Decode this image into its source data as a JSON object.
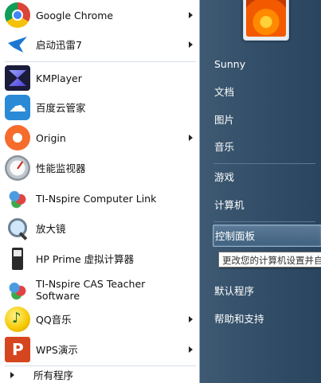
{
  "programs": [
    {
      "label": "Google Chrome",
      "icon": "chrome-icon",
      "has_submenu": true
    },
    {
      "label": "启动迅雷7",
      "icon": "xunlei-icon",
      "has_submenu": true
    },
    {
      "label": "KMPlayer",
      "icon": "kmplayer-icon",
      "has_submenu": false
    },
    {
      "label": "百度云管家",
      "icon": "baidu-cloud-icon",
      "has_submenu": false
    },
    {
      "label": "Origin",
      "icon": "origin-icon",
      "has_submenu": true
    },
    {
      "label": "性能监视器",
      "icon": "performance-monitor-icon",
      "has_submenu": false
    },
    {
      "label": "TI-Nspire Computer Link",
      "icon": "ti-nspire-icon",
      "has_submenu": false
    },
    {
      "label": "放大镜",
      "icon": "magnifier-icon",
      "has_submenu": false
    },
    {
      "label": "HP Prime 虚拟计算器",
      "icon": "hp-calculator-icon",
      "has_submenu": false
    },
    {
      "label_line1": "TI-Nspire CAS Teacher",
      "label_line2": "Software",
      "icon": "ti-nspire-cas-icon",
      "has_submenu": false
    },
    {
      "label": "QQ音乐",
      "icon": "qq-music-icon",
      "has_submenu": true
    },
    {
      "label": "WPS演示",
      "icon": "wps-icon",
      "has_submenu": true
    }
  ],
  "all_programs": "所有程序",
  "right_pane": {
    "user": "Sunny",
    "documents": "文档",
    "pictures": "图片",
    "music": "音乐",
    "games": "游戏",
    "computer": "计算机",
    "control_panel": "控制面板",
    "default_programs": "默认程序",
    "help_support": "帮助和支持"
  },
  "tooltip": "更改您的计算机设置并自",
  "colors": {
    "right_pane_bg": "#34506a",
    "highlight": "#4f6f8e",
    "left_pane_bg": "#ffffff"
  }
}
